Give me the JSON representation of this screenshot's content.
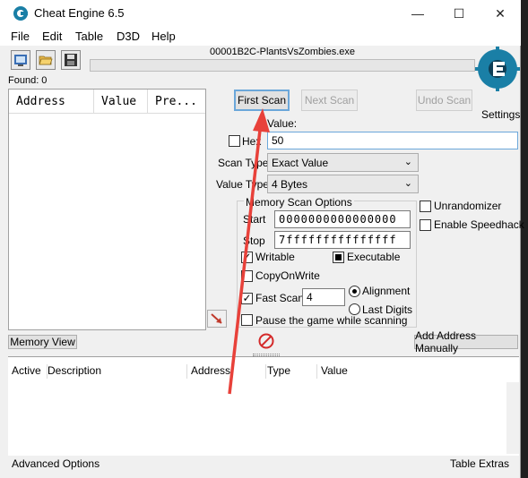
{
  "window": {
    "title": "Cheat Engine 6.5",
    "minimize_glyph": "—",
    "maximize_glyph": "☐",
    "close_glyph": "✕"
  },
  "menu": [
    "File",
    "Edit",
    "Table",
    "D3D",
    "Help"
  ],
  "process": {
    "name": "00001B2C-PlantsVsZombies.exe"
  },
  "found": "Found: 0",
  "result_list": {
    "columns": [
      "Address",
      "Value",
      "Pre..."
    ]
  },
  "buttons": {
    "first_scan": "First Scan",
    "next_scan": "Next Scan",
    "undo_scan": "Undo Scan",
    "memory_view": "Memory View",
    "add_address_manually": "Add Address Manually"
  },
  "settings_label": "Settings",
  "value": {
    "label": "Value:",
    "input": "50",
    "hex_label": "Hex"
  },
  "scan_type": {
    "label": "Scan Type",
    "selected": "Exact Value"
  },
  "value_type": {
    "label": "Value Type",
    "selected": "4 Bytes"
  },
  "memory_scan_options": {
    "title": "Memory Scan Options",
    "start_label": "Start",
    "start_value": "0000000000000000",
    "stop_label": "Stop",
    "stop_value": "7fffffffffffffff",
    "writable": "Writable",
    "executable": "Executable",
    "copy_on_write": "CopyOnWrite",
    "fast_scan": "Fast Scan",
    "fast_scan_value": "4",
    "alignment": "Alignment",
    "last_digits": "Last Digits",
    "pause_game": "Pause the game while scanning"
  },
  "extra_options": {
    "unrandomizer": "Unrandomizer",
    "enable_speedhack": "Enable Speedhack"
  },
  "address_table": {
    "columns": [
      "Active",
      "Description",
      "Address",
      "Type",
      "Value"
    ]
  },
  "bottom": {
    "advanced_options": "Advanced Options",
    "table_extras": "Table Extras"
  },
  "colors": {
    "arrow": "#e8413a",
    "logo": "#1a7fa6",
    "focus": "#6ba7da"
  }
}
